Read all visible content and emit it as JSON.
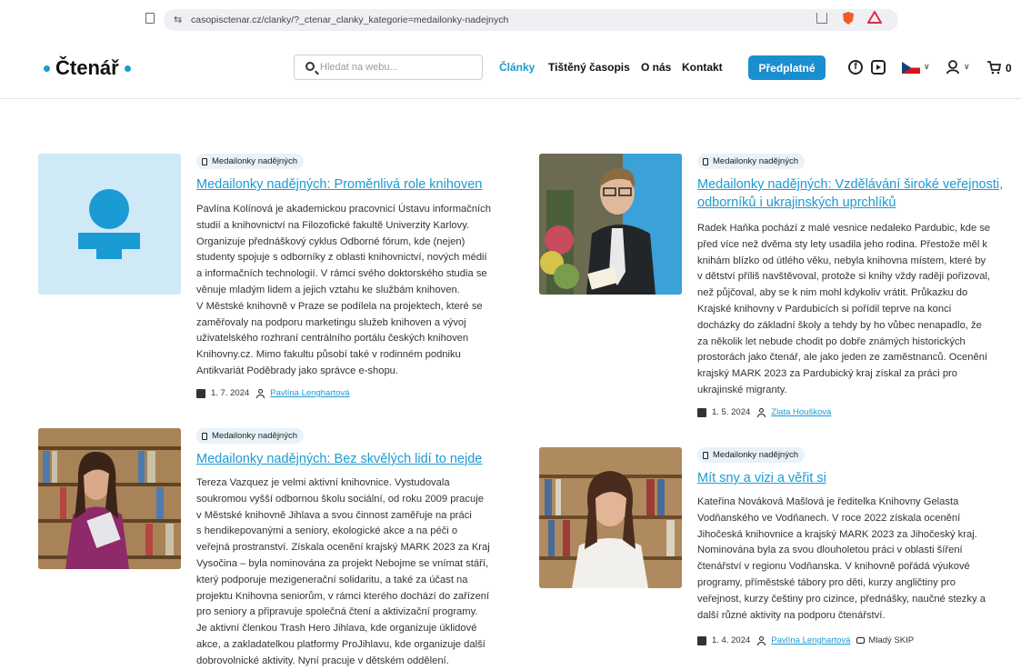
{
  "browser": {
    "url": "casopisctenar.cz/clanky/?_ctenar_clanky_kategorie=medailonky-nadejnych"
  },
  "header": {
    "logo": "Čtenář",
    "search_placeholder": "Hledat na webu...",
    "nav": [
      "Články",
      "Tištěný časopis",
      "O nás",
      "Kontakt"
    ],
    "cta_label": "Předplatné",
    "cart_count": "0",
    "accent_color": "#1a9bd4"
  },
  "articles": [
    {
      "tag": "Medailonky nadějných",
      "title": "Medailonky nadějných: Proměnlivá role knihoven",
      "body_lines": [
        "Pavlína Kolínová je akademickou pracovnicí Ústavu informačních",
        "studií a knihovnictví na Filozofické fakultě Univerzity Karlovy.",
        "Organizuje přednáškový cyklus Odborné fórum, kde (nejen)",
        "studenty spojuje s odborníky z oblasti knihovnictví, nových médií",
        "a informačních technologií. V rámci svého doktorského studia se",
        "věnuje mladým lidem a jejich vztahu ke službám knihoven.",
        "V Městské knihovně v Praze se podílela na projektech, které se",
        "zaměřovaly na podporu marketingu služeb knihoven a vývoj",
        "uživatelského rozhraní centrálního portálu českých knihoven",
        "Knihovny.cz. Mimo fakultu působí také v rodinném podniku",
        "Antikvariát Poděbrady jako správce e-shopu."
      ],
      "date": "1. 7. 2024",
      "author": "Pavlína Lenghartová"
    },
    {
      "tag": "Medailonky nadějných",
      "title_lines": [
        "Medailonky nadějných: Vzdělávání široké veřejnosti,",
        "odborníků i ukrajinských uprchlíků"
      ],
      "body_lines": [
        "Radek Haňka pochází z malé vesnice nedaleko Pardubic, kde se",
        "před více než dvěma sty lety usadila jeho rodina. Přestože měl k",
        "knihám blízko od útlého věku, nebyla knihovna místem, které by",
        "v dětství příliš navštěvoval, protože si knihy vždy raději pořizoval,",
        "než půjčoval, aby se k nim mohl kdykoliv vrátit. Průkazku do",
        "Krajské knihovny v Pardubicích si pořídil teprve na konci",
        "docházky do základní školy a tehdy by ho vůbec nenapadlo, že",
        "za několik let nebude chodit po dobře známých historických",
        "prostorách jako čtenář, ale jako jeden ze zaměstnanců. Ocenění",
        "krajský MARK 2023 za Pardubický kraj získal za práci pro",
        "ukrajinské migranty."
      ],
      "date": "1. 5. 2024",
      "author": "Zlata Houšková"
    },
    {
      "tag": "Medailonky nadějných",
      "title": "Medailonky nadějných: Bez skvělých lidí to nejde",
      "body_lines": [
        "Tereza Vazquez je velmi aktivní knihovnice. Vystudovala",
        "soukromou vyšší odbornou školu sociální, od roku 2009 pracuje",
        "v Městské knihovně Jihlava a svou činnost zaměřuje na práci",
        "s hendikepovanými a seniory, ekologické akce a na péči o",
        "veřejná prostranství. Získala ocenění krajský MARK 2023 za Kraj",
        "Vysočina – byla nominována za projekt Nebojme se vnímat stáří,",
        "který podporuje mezigenerační solidaritu, a také za účast na",
        "projektu Knihovna seniorům, v rámci kterého dochází do zařízení",
        "pro seniory a připravuje společná čtení a aktivizační programy.",
        "Je aktivní členkou Trash Hero Jihlava, kde organizuje úklidové",
        "akce, a zakladatelkou platformy ProJihlavu, kde organizuje další",
        "dobrovolnické aktivity. Nyní pracuje v dětském oddělení."
      ]
    },
    {
      "tag": "Medailonky nadějných",
      "title": "Mít sny a vizi a věřit si",
      "body_lines": [
        "Kateřina Nováková Mašlová je ředitelka Knihovny Gelasta",
        "Vodňanského ve Vodňanech. V roce 2022 získala ocenění",
        "Jihočeská knihovnice a krajský MARK 2023 za Jihočeský kraj.",
        "Nominována byla za svou dlouholetou práci v oblasti šíření",
        "čtenářství v regionu Vodňanska. V knihovně pořádá výukové",
        "programy, příměstské tábory pro děti, kurzy angličtiny pro",
        "veřejnost, kurzy češtiny pro cizince, přednášky, naučné stezky a",
        "další různé aktivity na podporu čtenářství."
      ],
      "date": "1. 4. 2024",
      "author": "Pavlína Lenghartová",
      "extra_tag": "Mladý SKIP"
    }
  ]
}
